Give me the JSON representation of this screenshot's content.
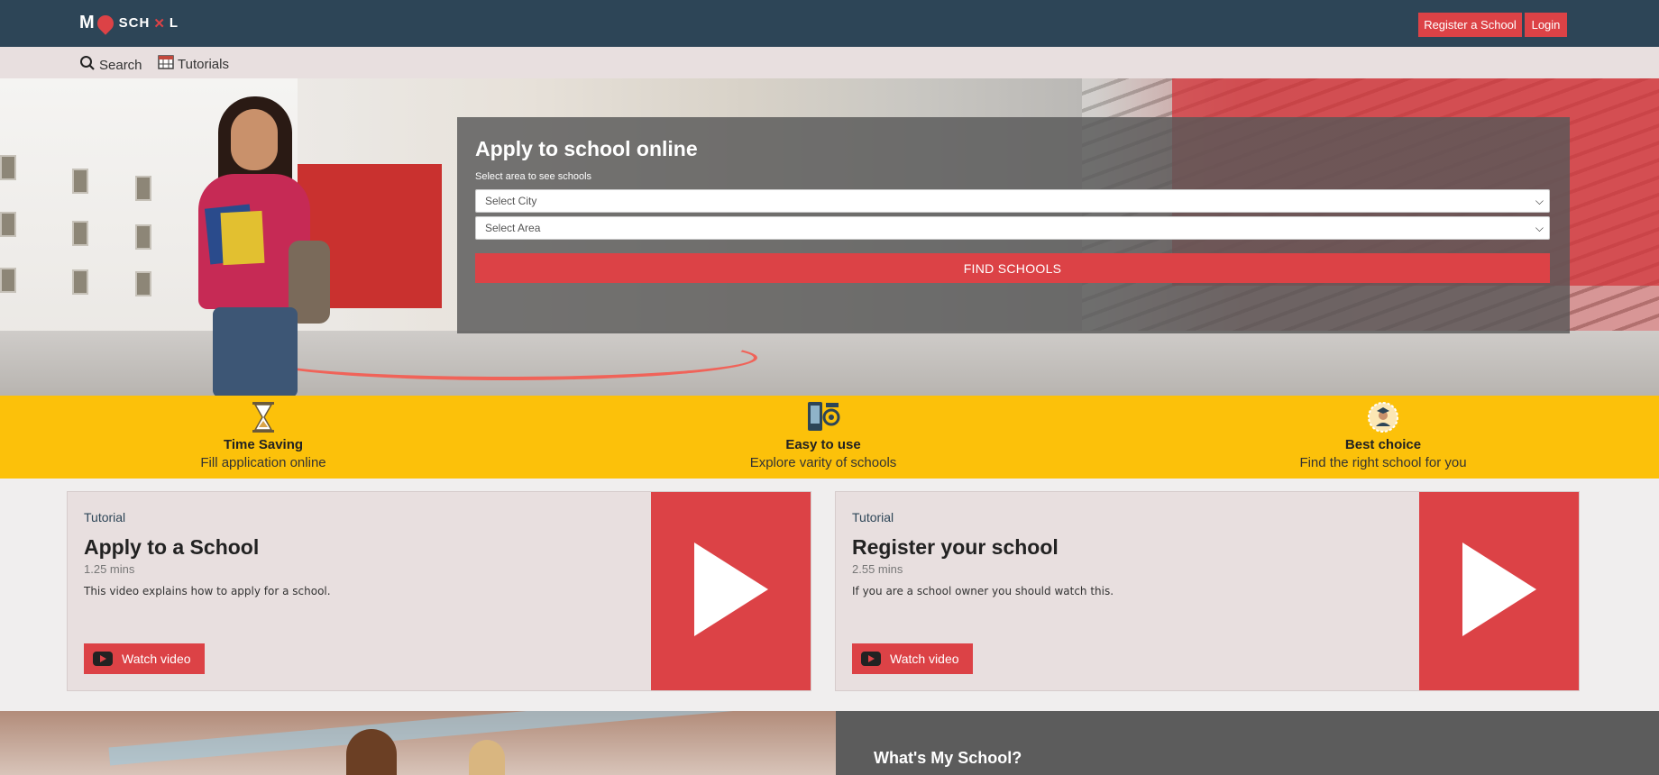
{
  "brand": {
    "logo_text_main": "M",
    "logo_text_rest": "SCH",
    "logo_text_end": "L",
    "accent_color": "#dc4246",
    "nav_color": "#2d4557",
    "feature_strip_color": "#fcc10a"
  },
  "header": {
    "register_label": "Register a School",
    "login_label": "Login"
  },
  "subnav": {
    "search_label": "Search",
    "search_icon": "search-icon",
    "tutorials_label": "Tutorials",
    "tutorials_icon": "calendar-icon"
  },
  "apply": {
    "title": "Apply to school online",
    "area_label": "Select area to see schools",
    "city_select": "Select City",
    "area_select": "Select Area",
    "find_button": "FIND SCHOOLS"
  },
  "features": [
    {
      "icon": "hourglass-icon",
      "title": "Time Saving",
      "subtitle": "Fill application online"
    },
    {
      "icon": "phone-gear-icon",
      "title": "Easy to use",
      "subtitle": "Explore varity of schools"
    },
    {
      "icon": "graduate-badge-icon",
      "title": "Best choice",
      "subtitle": "Find the right school for you"
    }
  ],
  "tutorials": [
    {
      "kicker": "Tutorial",
      "title": "Apply to a School",
      "duration": "1.25 mins",
      "description": "This video explains how to apply for a school.",
      "button": "Watch video"
    },
    {
      "kicker": "Tutorial",
      "title": "Register your school",
      "duration": "2.55 mins",
      "description": "If you are a school owner you should watch this.",
      "button": "Watch video"
    }
  ],
  "about": {
    "title": "What's My School?"
  }
}
